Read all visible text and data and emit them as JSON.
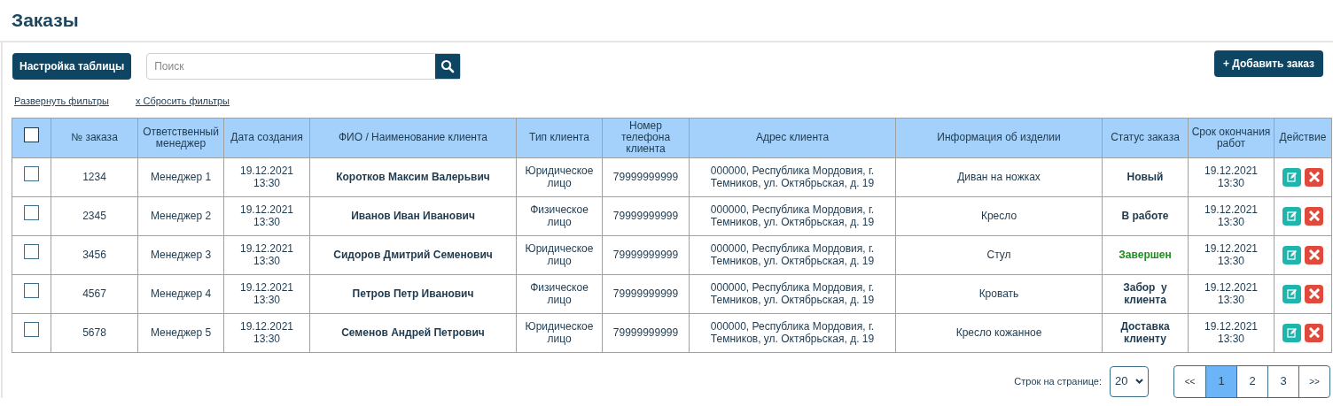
{
  "page": {
    "title": "Заказы"
  },
  "toolbar": {
    "settings_button": "Настройка таблицы",
    "search": {
      "placeholder": "Поиск"
    },
    "add_button": "+ Добавить заказ"
  },
  "filters": {
    "expand_link": "Развернуть фильтры",
    "reset_link": "x Сбросить фильтры"
  },
  "table": {
    "select_all": {
      "checked": false
    },
    "columns": [
      "№ заказа",
      "Ответственный менеджер",
      "Дата создания",
      "ФИО / Наименование клиента",
      "Тип клиента",
      "Номер телефона клиента",
      "Адрес клиента",
      "Информация об изделии",
      "Статус заказа",
      "Срок окончания работ",
      "Действие"
    ],
    "rows": [
      {
        "checked": false,
        "number": "1234",
        "manager": "Менеджер 1",
        "created": "19.12.2021 13:30",
        "client": "Коротков Максим Валерьвич",
        "client_type": "Юридическое лицо",
        "phone": "79999999999",
        "address": "000000, Республика Мордовия, г. Темников, ул. Октябрьская, д. 19",
        "product": "Диван на ножках",
        "status": {
          "text": "Новый",
          "color": "#1e3a4f"
        },
        "deadline": "19.12.2021 13:30"
      },
      {
        "checked": false,
        "number": "2345",
        "manager": "Менеджер 2",
        "created": "19.12.2021 13:30",
        "client": "Иванов Иван Иванович",
        "client_type": "Физическое лицо",
        "phone": "79999999999",
        "address": "000000, Республика Мордовия, г. Темников, ул. Октябрьская, д. 19",
        "product": "Кресло",
        "status": {
          "text": "В работе",
          "color": "#1e3a4f"
        },
        "deadline": "19.12.2021 13:30"
      },
      {
        "checked": false,
        "number": "3456",
        "manager": "Менеджер 3",
        "created": "19.12.2021 13:30",
        "client": "Сидоров Дмитрий Семенович",
        "client_type": "Юридическое лицо",
        "phone": "79999999999",
        "address": "000000, Республика Мордовия, г. Темников, ул. Октябрьская, д. 19",
        "product": "Стул",
        "status": {
          "text": "Завершен",
          "color": "#1f8f1f"
        },
        "deadline": "19.12.2021 13:30"
      },
      {
        "checked": false,
        "number": "4567",
        "manager": "Менеджер 4",
        "created": "19.12.2021 13:30",
        "client": "Петров Петр Иванович",
        "client_type": "Физическое лицо",
        "phone": "79999999999",
        "address": "000000, Республика Мордовия, г. Темников, ул. Октябрьская, д. 19",
        "product": "Кровать",
        "status": {
          "text": "Забор  у клиента",
          "color": "#1e3a4f"
        },
        "deadline": "19.12.2021 13:30"
      },
      {
        "checked": false,
        "number": "5678",
        "manager": "Менеджер 5",
        "created": "19.12.2021 13:30",
        "client": "Семенов Андрей Петрович",
        "client_type": "Юридическое лицо",
        "phone": "79999999999",
        "address": "000000, Республика Мордовия, г. Темников, ул. Октябрьская, д. 19",
        "product": "Кресло кожанное",
        "status": {
          "text": "Доставка клиенту",
          "color": "#1e3a4f"
        },
        "deadline": "19.12.2021 13:30"
      }
    ]
  },
  "pagination": {
    "rows_label": "Строк на странице:",
    "rows_per_page": "20",
    "first": "<<",
    "pages": [
      {
        "label": "1",
        "selected": true
      },
      {
        "label": "2",
        "selected": false
      },
      {
        "label": "3",
        "selected": false
      }
    ],
    "last": ">>"
  }
}
